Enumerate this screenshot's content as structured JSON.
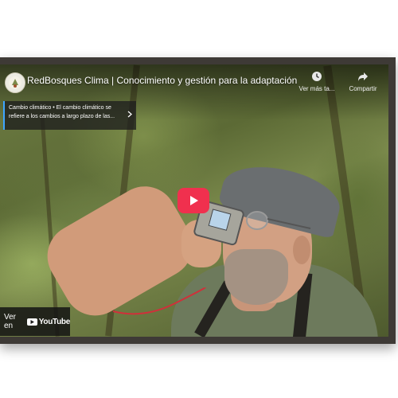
{
  "video": {
    "title": "RedBosques Clima | Conocimiento y gestión para la adaptación de l...",
    "watch_later_label": "Ver más ta...",
    "share_label": "Compartir"
  },
  "info_card": {
    "text": "Cambio climático • El cambio climático se refiere a los cambios a largo plazo de las..."
  },
  "watch_on": {
    "label": "Ver en",
    "brand": "YouTube"
  },
  "icons": {
    "avatar": "channel-logo-icon",
    "watch_later": "clock-icon",
    "share": "share-arrow-icon",
    "card": "chevron-right-icon",
    "play": "play-icon"
  },
  "colors": {
    "play_button": "#f0304e",
    "card_accent": "#3ea6ff",
    "frame": "#3e3a36"
  }
}
